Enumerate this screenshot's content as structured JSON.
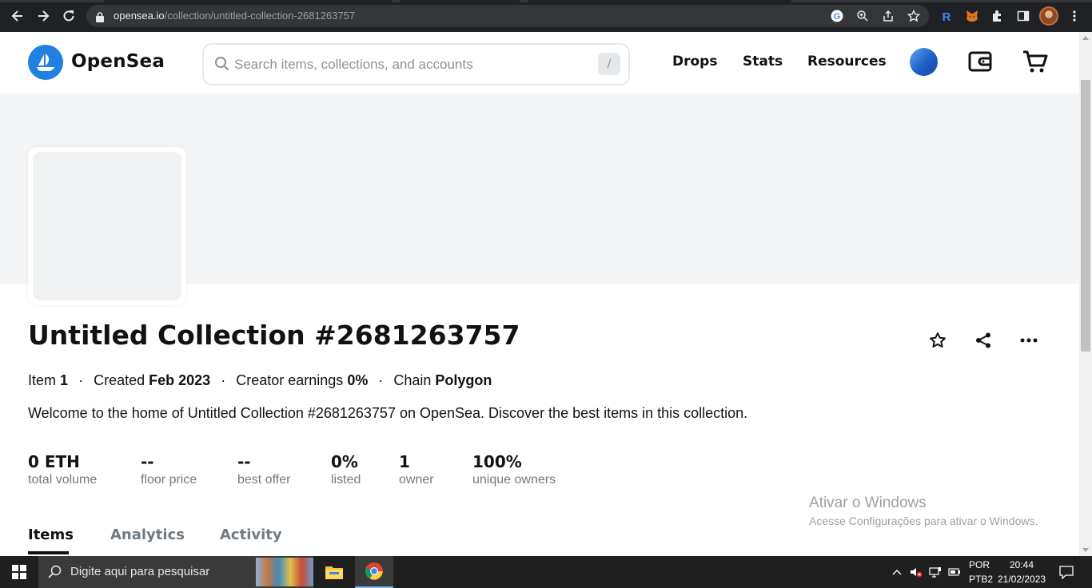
{
  "browser": {
    "url_domain": "opensea.io",
    "url_path": "/collection/untitled-collection-2681263757"
  },
  "header": {
    "brand": "OpenSea",
    "search_placeholder": "Search items, collections, and accounts",
    "search_shortcut": "/",
    "nav": [
      "Drops",
      "Stats",
      "Resources"
    ]
  },
  "collection": {
    "title": "Untitled Collection #2681263757",
    "meta": {
      "items_label": "Item",
      "items_value": "1",
      "created_label": "Created",
      "created_value": "Feb 2023",
      "earnings_label": "Creator earnings",
      "earnings_value": "0%",
      "chain_label": "Chain",
      "chain_value": "Polygon",
      "separator": "·"
    },
    "description": "Welcome to the home of Untitled Collection #2681263757 on OpenSea. Discover the best items in this collection.",
    "stats": [
      {
        "value": "0 ETH",
        "label": "total volume"
      },
      {
        "value": "--",
        "label": "floor price"
      },
      {
        "value": "--",
        "label": "best offer"
      },
      {
        "value": "0%",
        "label": "listed"
      },
      {
        "value": "1",
        "label": "owner"
      },
      {
        "value": "100%",
        "label": "unique owners"
      }
    ],
    "tabs": [
      "Items",
      "Analytics",
      "Activity"
    ]
  },
  "watermark": {
    "title": "Ativar o Windows",
    "subtitle": "Acesse Configurações para ativar o Windows."
  },
  "taskbar": {
    "search_text": "Digite aqui para pesquisar",
    "lang_top": "POR",
    "lang_bottom": "PTB2",
    "time": "20:44",
    "date": "21/02/2023"
  },
  "colors": {
    "accent": "#2081e2",
    "text": "#121212",
    "muted": "#707a83",
    "banner": "#f4f5f7"
  }
}
